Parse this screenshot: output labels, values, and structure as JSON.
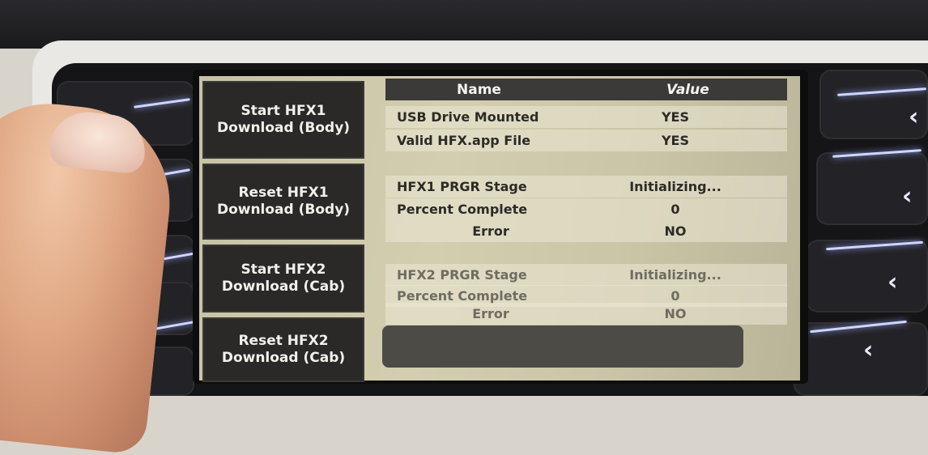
{
  "menu": [
    {
      "line1": "Start HFX1",
      "line2": "Download (Body)"
    },
    {
      "line1": "Reset HFX1",
      "line2": "Download (Body)"
    },
    {
      "line1": "Start HFX2",
      "line2": "Download (Cab)"
    },
    {
      "line1": "Reset HFX2",
      "line2": "Download (Cab)"
    }
  ],
  "table": {
    "headers": {
      "name": "Name",
      "value": "Value"
    },
    "rows": [
      {
        "name": "USB Drive Mounted",
        "value": "YES"
      },
      {
        "name": "Valid HFX.app File",
        "value": "YES"
      },
      {
        "name": "HFX1 PRGR Stage",
        "value": "Initializing..."
      },
      {
        "name": "Percent Complete",
        "value": "0"
      },
      {
        "name": "Error",
        "value": "NO"
      },
      {
        "name": "HFX2 PRGR Stage",
        "value": "Initializing..."
      },
      {
        "name": "Percent Complete",
        "value": "0"
      },
      {
        "name": "Error",
        "value": "NO"
      }
    ]
  },
  "icons": {
    "left_key_arrow": "chevron-right-icon",
    "right_key_arrow": "chevron-left-icon"
  },
  "colors": {
    "lcd_background": "#cdc8aa",
    "button_background": "#2a2927",
    "key_glow": "#cfd6ff"
  }
}
